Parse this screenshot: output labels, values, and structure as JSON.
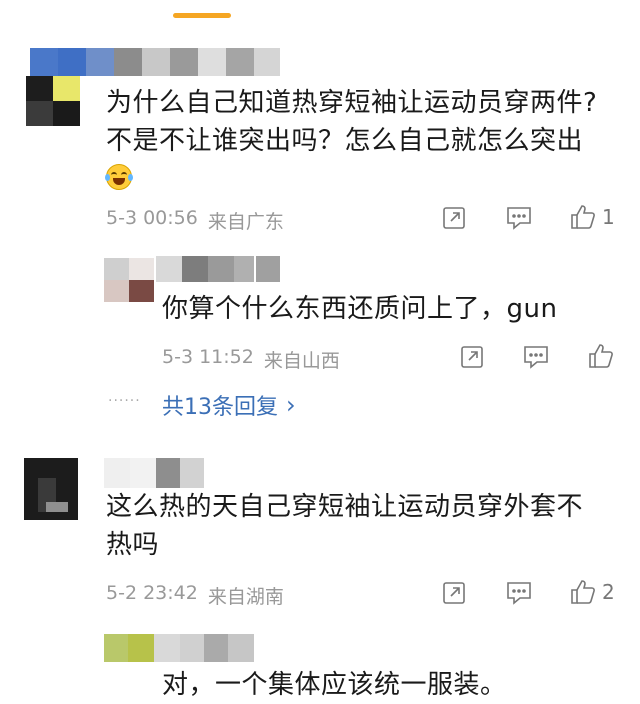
{
  "accent_color": "#f5a623",
  "link_color": "#3b6fb6",
  "comments": [
    {
      "text_lines": [
        "为什么自己知道热穿短袖让运动员穿两件?",
        "不是不让谁突出吗？怎么自己就怎么突出"
      ],
      "emoji": "laughing-crying-emoji",
      "date": "5-3 00:56",
      "location": "来自广东",
      "likes": "1"
    },
    {
      "text_lines": [
        "你算个什么东西还质问上了，gun"
      ],
      "date": "5-3 11:52",
      "location": "来自山西",
      "likes": ""
    },
    {
      "more_replies": "共13条回复",
      "more_arrow": "›",
      "dots": "······"
    },
    {
      "text_lines": [
        "这么热的天自己穿短袖让运动员穿外套不",
        "热吗"
      ],
      "date": "5-2 23:42",
      "location": "来自湖南",
      "likes": "2"
    },
    {
      "text_lines": [
        "对，一个集体应该统一服装。"
      ]
    }
  ]
}
